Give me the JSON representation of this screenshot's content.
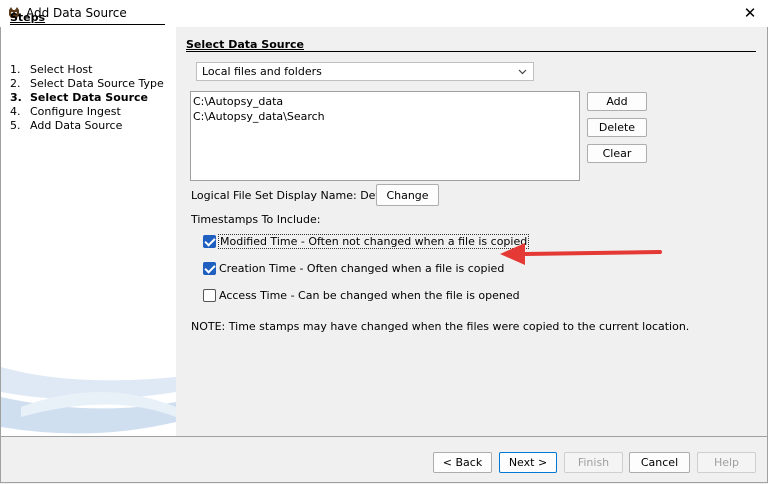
{
  "window": {
    "title": "Add Data Source",
    "close_label": "✕"
  },
  "steps": {
    "title": "Steps",
    "items": [
      {
        "num": "1.",
        "label": "Select Host"
      },
      {
        "num": "2.",
        "label": "Select Data Source Type"
      },
      {
        "num": "3.",
        "label": "Select Data Source"
      },
      {
        "num": "4.",
        "label": "Configure Ingest"
      },
      {
        "num": "5.",
        "label": "Add Data Source"
      }
    ],
    "current_index": 2
  },
  "content": {
    "title": "Select Data Source",
    "source_type": {
      "selected": "Local files and folders"
    },
    "paths": [
      "C:\\Autopsy_data",
      "C:\\Autopsy_data\\Search"
    ],
    "buttons": {
      "add": "Add",
      "delete": "Delete",
      "clear": "Clear"
    },
    "display_name_label": "Logical File Set Display Name: Default",
    "change_label": "Change",
    "timestamps_label": "Timestamps To Include:",
    "timestamps": [
      {
        "label": "Modified Time - Often not changed when a file is copied",
        "checked": true
      },
      {
        "label": "Creation Time - Often changed when a file is copied",
        "checked": true
      },
      {
        "label": "Access Time - Can be changed when the file is opened",
        "checked": false
      }
    ],
    "note": "NOTE: Time stamps may have changed when the files were copied to the current location."
  },
  "footer": {
    "back": "< Back",
    "next": "Next >",
    "finish": "Finish",
    "cancel": "Cancel",
    "help": "Help"
  },
  "colors": {
    "annotation_arrow": "#e53935",
    "checkbox_checked": "#1f5fbf"
  }
}
